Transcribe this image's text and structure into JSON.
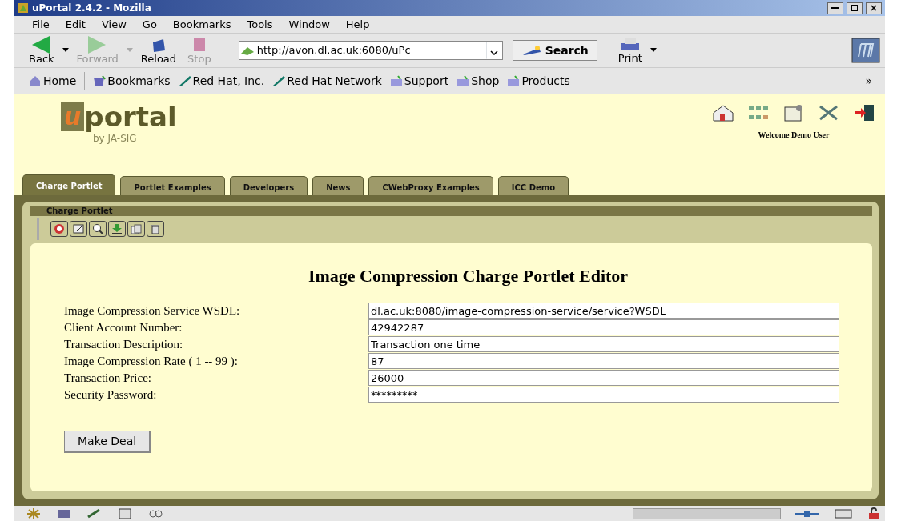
{
  "window": {
    "title": "uPortal 2.4.2 - Mozilla"
  },
  "menu": [
    "File",
    "Edit",
    "View",
    "Go",
    "Bookmarks",
    "Tools",
    "Window",
    "Help"
  ],
  "nav_buttons": [
    {
      "label": "Back",
      "disabled": false
    },
    {
      "label": "Forward",
      "disabled": true
    },
    {
      "label": "Reload",
      "disabled": false
    },
    {
      "label": "Stop",
      "disabled": true
    }
  ],
  "address": {
    "value": "http://avon.dl.ac.uk:6080/uPc"
  },
  "search_button": "Search",
  "print_button": "Print",
  "bookmarks": [
    {
      "label": "Home",
      "kind": "home"
    },
    {
      "label": "Bookmarks",
      "kind": "folder"
    },
    {
      "label": "Red Hat, Inc.",
      "kind": "link"
    },
    {
      "label": "Red Hat Network",
      "kind": "link"
    },
    {
      "label": "Support",
      "kind": "tray"
    },
    {
      "label": "Shop",
      "kind": "tray"
    },
    {
      "label": "Products",
      "kind": "tray"
    }
  ],
  "bookmarks_more": "»",
  "portal": {
    "logo_letter": "u",
    "logo_word": "portal",
    "logo_by": "by JA-SIG",
    "welcome": "Welcome Demo User"
  },
  "tabs": [
    {
      "label": "Charge Portlet",
      "selected": true
    },
    {
      "label": "Portlet Examples",
      "selected": false
    },
    {
      "label": "Developers",
      "selected": false
    },
    {
      "label": "News",
      "selected": false
    },
    {
      "label": "CWebProxy Examples",
      "selected": false
    },
    {
      "label": "ICC Demo",
      "selected": false
    }
  ],
  "portlet": {
    "title": "Charge Portlet",
    "heading": "Image Compression Charge Portlet Editor",
    "fields": [
      {
        "label": "Image Compression Service WSDL:",
        "value": "dl.ac.uk:8080/image-compression-service/service?WSDL"
      },
      {
        "label": "Client Account Number:",
        "value": "42942287"
      },
      {
        "label": "Transaction Description:",
        "value": "Transaction one time"
      },
      {
        "label": "Image Compression Rate ( 1 -- 99 ):",
        "value": "87"
      },
      {
        "label": "Transaction Price:",
        "value": "26000"
      },
      {
        "label": "Security Password:",
        "value": "*********"
      }
    ],
    "button": "Make Deal"
  }
}
